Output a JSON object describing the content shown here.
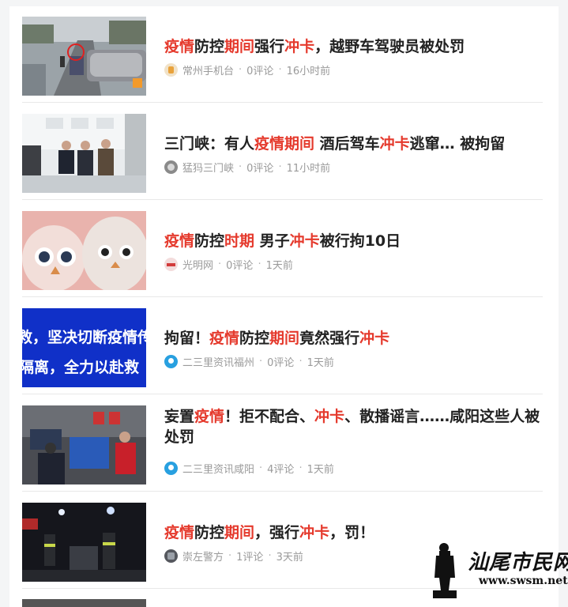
{
  "articles": [
    {
      "title_parts": [
        {
          "text": "疫情",
          "hl": true
        },
        {
          "text": "防控",
          "hl": false
        },
        {
          "text": "期间",
          "hl": true
        },
        {
          "text": "强行",
          "hl": false
        },
        {
          "text": "冲卡",
          "hl": true
        },
        {
          "text": "，越野车驾驶员被处罚",
          "hl": false
        }
      ],
      "source": "常州手机台",
      "comments": "0评论",
      "time": "16小时前",
      "icon": "changzhou-tv-icon"
    },
    {
      "title_parts": [
        {
          "text": "三门峡：有人",
          "hl": false
        },
        {
          "text": "疫情期间",
          "hl": true
        },
        {
          "text": " 酒后驾车",
          "hl": false
        },
        {
          "text": "冲卡",
          "hl": true
        },
        {
          "text": "逃窜… 被拘留",
          "hl": false
        }
      ],
      "source": "猛犸三门峡",
      "comments": "0评论",
      "time": "11小时前",
      "icon": "mengma-icon"
    },
    {
      "title_parts": [
        {
          "text": "疫情",
          "hl": true
        },
        {
          "text": "防控",
          "hl": false
        },
        {
          "text": "时期",
          "hl": true
        },
        {
          "text": " 男子",
          "hl": false
        },
        {
          "text": "冲卡",
          "hl": true
        },
        {
          "text": "被行拘10日",
          "hl": false
        }
      ],
      "source": "光明网",
      "comments": "0评论",
      "time": "1天前",
      "icon": "guangming-icon"
    },
    {
      "title_parts": [
        {
          "text": "拘留！",
          "hl": false
        },
        {
          "text": "疫情",
          "hl": true
        },
        {
          "text": "防控",
          "hl": false
        },
        {
          "text": "期间",
          "hl": true
        },
        {
          "text": "竟然强行",
          "hl": false
        },
        {
          "text": "冲卡",
          "hl": true
        }
      ],
      "source": "二三里资讯福州",
      "comments": "0评论",
      "time": "1天前",
      "icon": "location-pin-icon"
    },
    {
      "title_parts": [
        {
          "text": "妄置",
          "hl": false
        },
        {
          "text": "疫情",
          "hl": true
        },
        {
          "text": "！拒不配合、",
          "hl": false
        },
        {
          "text": "冲卡",
          "hl": true
        },
        {
          "text": "、散播谣言……咸阳这些人被处罚",
          "hl": false
        }
      ],
      "source": "二三里资讯咸阳",
      "comments": "4评论",
      "time": "1天前",
      "icon": "location-pin-icon"
    },
    {
      "title_parts": [
        {
          "text": "疫情",
          "hl": true
        },
        {
          "text": "防控",
          "hl": false
        },
        {
          "text": "期间",
          "hl": true
        },
        {
          "text": "，强行",
          "hl": false
        },
        {
          "text": "冲卡",
          "hl": true
        },
        {
          "text": "，罚！",
          "hl": false
        }
      ],
      "source": "崇左警方",
      "comments": "1评论",
      "time": "3天前",
      "icon": "police-badge-icon"
    }
  ],
  "thumb_banner_text": {
    "line1": "救，坚决切断疫情传",
    "line2": "隔离，全力以赴救"
  },
  "watermark": {
    "text": "汕尾市民网",
    "url": "www.swsm.net"
  },
  "colors": {
    "highlight": "#e53a2d",
    "title": "#222222",
    "meta": "#9a9a9a"
  }
}
